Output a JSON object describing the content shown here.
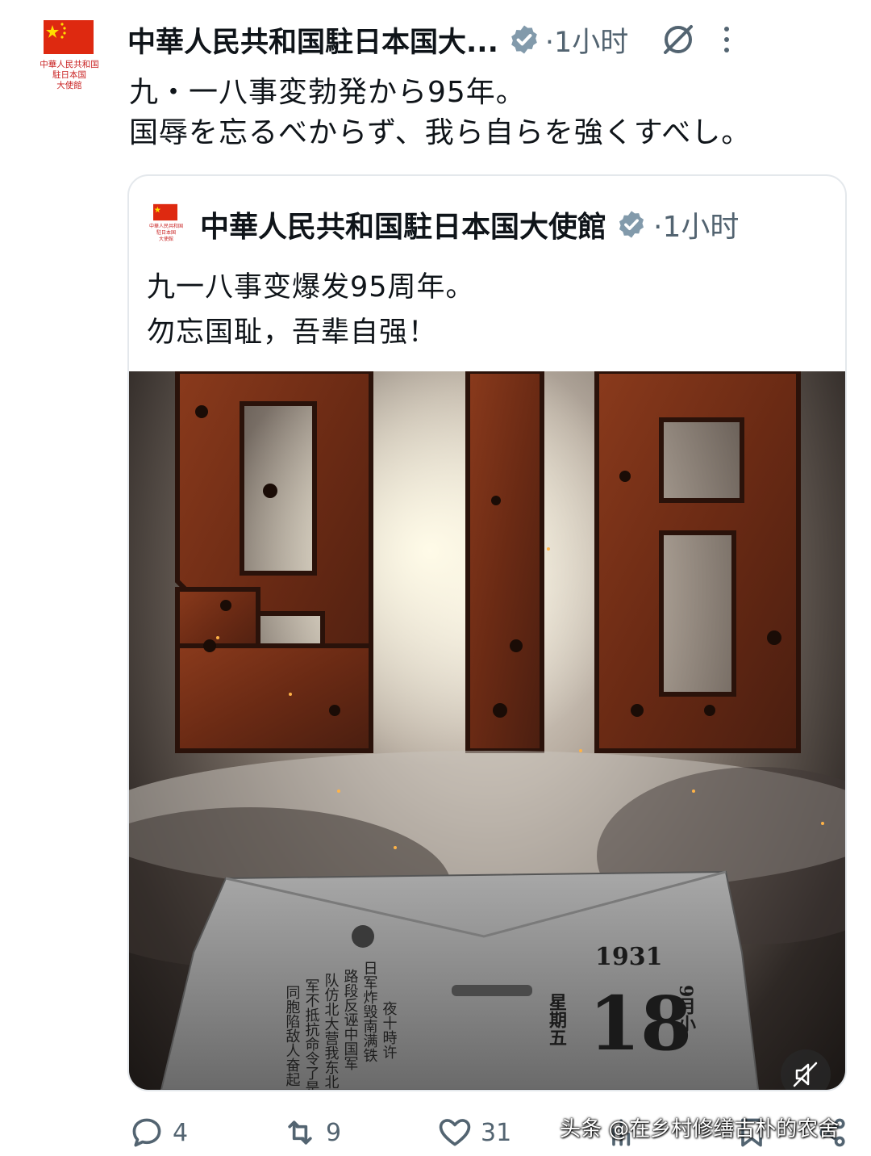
{
  "account": {
    "name": "中華人民共和国駐日本国大...",
    "avatar_text": "中華人民共和国\n駐日本国\n大使館",
    "time": "·1小时",
    "flag_color": "#de2910",
    "verified_color": "#829aab"
  },
  "tweet": {
    "lines": [
      "九・一八事変勃発から95年。",
      "国辱を忘るべからず、我ら自らを強くすべし。"
    ]
  },
  "quote": {
    "name": "中華人民共和国駐日本国大使館",
    "avatar_text": "中華人民共和国\n駐日本国\n大使館",
    "time": "·1小时",
    "lines": [
      "九一八事变爆发95周年。",
      "勿忘国耻，吾辈自强！"
    ],
    "image": {
      "headline": "918",
      "calendar_year": "1931",
      "calendar_day": "18",
      "calendar_month": "9月小",
      "calendar_weekday": "星期五",
      "stele_text": [
        "夜十時许",
        "日军炸毁南满铁",
        "路段反诬中国军",
        "队仿北大营我东北",
        "军不抵抗命令了是",
        "同胞陷敌人奋起"
      ]
    }
  },
  "actions": {
    "reply_count": "4",
    "retweet_count": "9",
    "like_count": "31"
  },
  "watermark": "头条 @在乡村修缮古朴的农舍"
}
